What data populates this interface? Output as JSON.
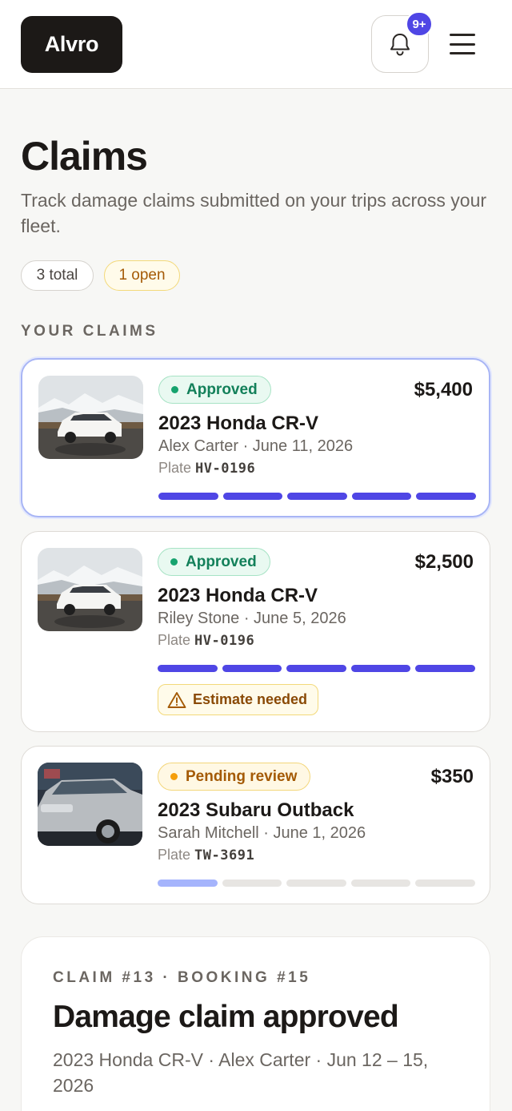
{
  "header": {
    "logo": "Alvro",
    "notification_count": "9+"
  },
  "page": {
    "title": "Claims",
    "subtitle": "Track damage claims submitted on your trips across your fleet.",
    "total_pill": "3 total",
    "open_pill": "1 open",
    "section_label": "YOUR CLAIMS"
  },
  "claims": [
    {
      "status": "Approved",
      "amount": "$5,400",
      "vehicle": "2023 Honda CR-V",
      "meta": "Alex Carter · June 11, 2026",
      "plate_label": "Plate",
      "plate": "HV-0196",
      "progress_steps_complete": 5,
      "progress_steps_total": 5
    },
    {
      "status": "Approved",
      "amount": "$2,500",
      "vehicle": "2023 Honda CR-V",
      "meta": "Riley Stone · June 5, 2026",
      "plate_label": "Plate",
      "plate": "HV-0196",
      "progress_steps_complete": 5,
      "progress_steps_total": 5,
      "warning": "Estimate needed"
    },
    {
      "status": "Pending review",
      "amount": "$350",
      "vehicle": "2023 Subaru Outback",
      "meta": "Sarah Mitchell · June 1, 2026",
      "plate_label": "Plate",
      "plate": "TW-3691",
      "progress_steps_complete": 1,
      "progress_steps_total": 5
    }
  ],
  "detail": {
    "kicker": "CLAIM #13 · BOOKING #15",
    "title": "Damage claim approved",
    "subtitle": "2023 Honda CR-V · Alex Carter · Jun 12 – 15, 2026"
  },
  "colors": {
    "accent": "#4f46e5",
    "approved": "#16a36e",
    "pending": "#f59e0b"
  },
  "icons": [
    "bell-icon",
    "menu-icon",
    "warning-icon"
  ]
}
